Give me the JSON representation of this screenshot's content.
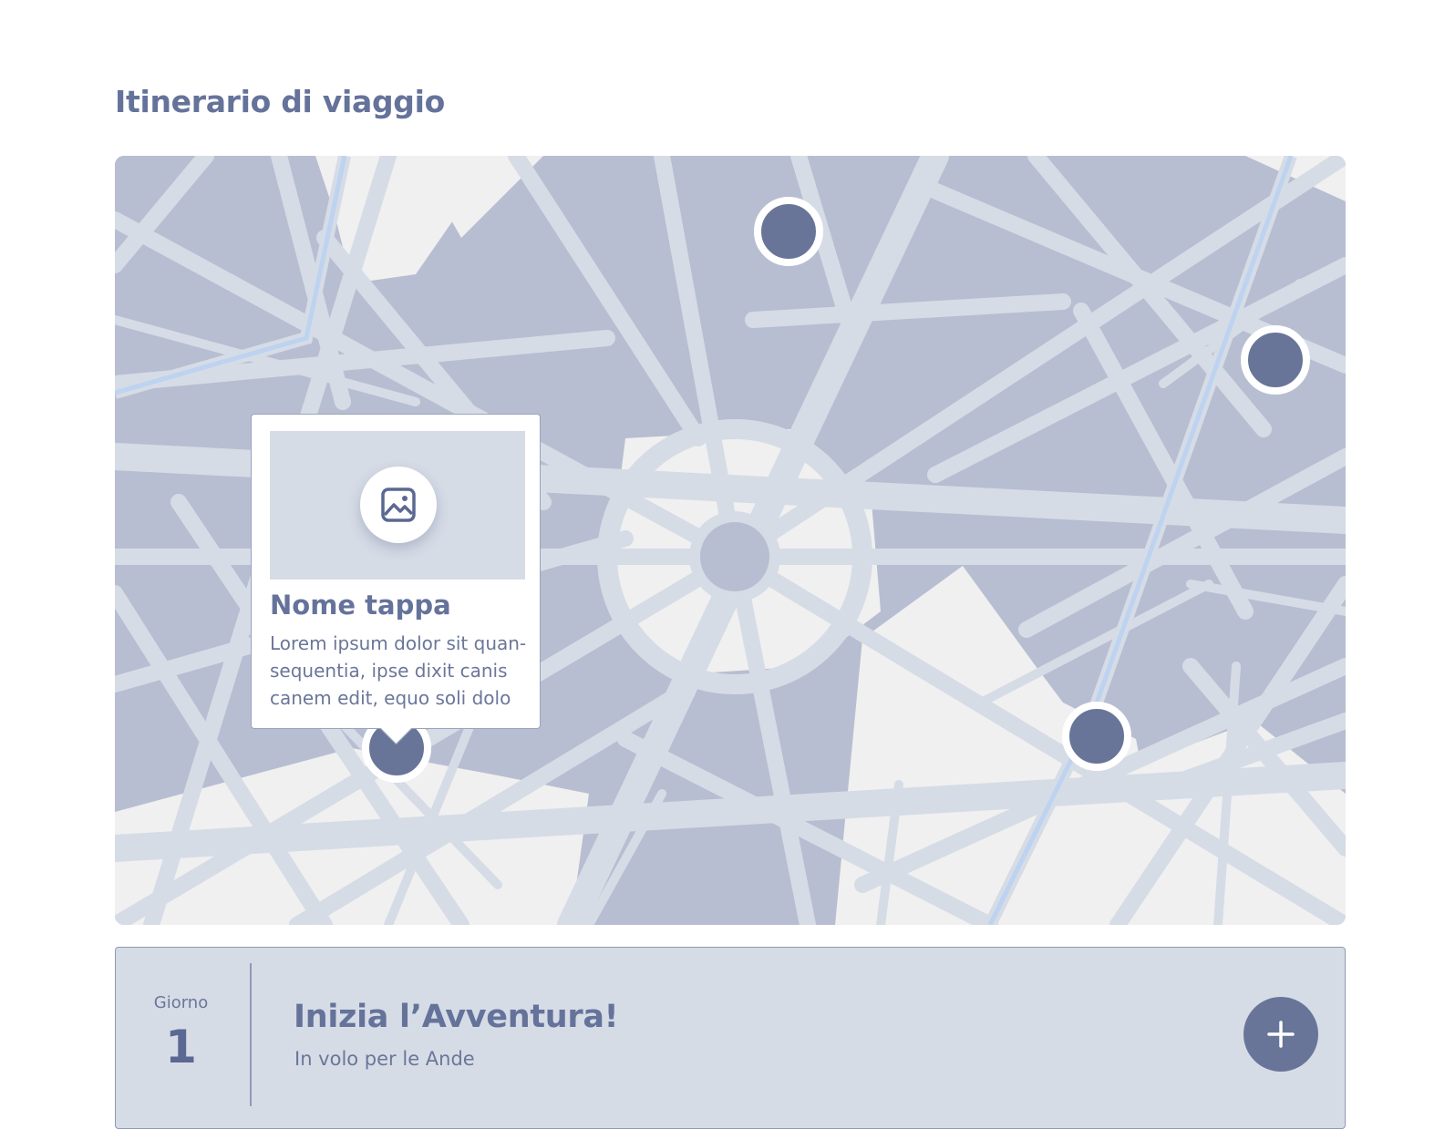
{
  "page": {
    "title": "Itinerario di viaggio"
  },
  "map": {
    "markers": [
      {
        "name": "marker-1"
      },
      {
        "name": "marker-2"
      },
      {
        "name": "marker-3"
      },
      {
        "name": "marker-4"
      }
    ],
    "popup": {
      "image_icon": "image-icon",
      "title": "Nome tappa",
      "description": "Lorem ipsum dolor sit quan-sequentia, ipse dixit canis canem edit, equo soli dolo"
    }
  },
  "day": {
    "label": "Giorno",
    "number": "1",
    "title": "Inizia l’Avventura!",
    "subtitle": "In volo per le Ande",
    "add_icon": "plus-icon"
  },
  "colors": {
    "accent": "#687599",
    "map_block": "#b8bed1",
    "map_road": "#d6dce6",
    "map_open_area": "#f0f0f0",
    "river": "#bdd3ef",
    "card_background": "#d6dce6"
  }
}
